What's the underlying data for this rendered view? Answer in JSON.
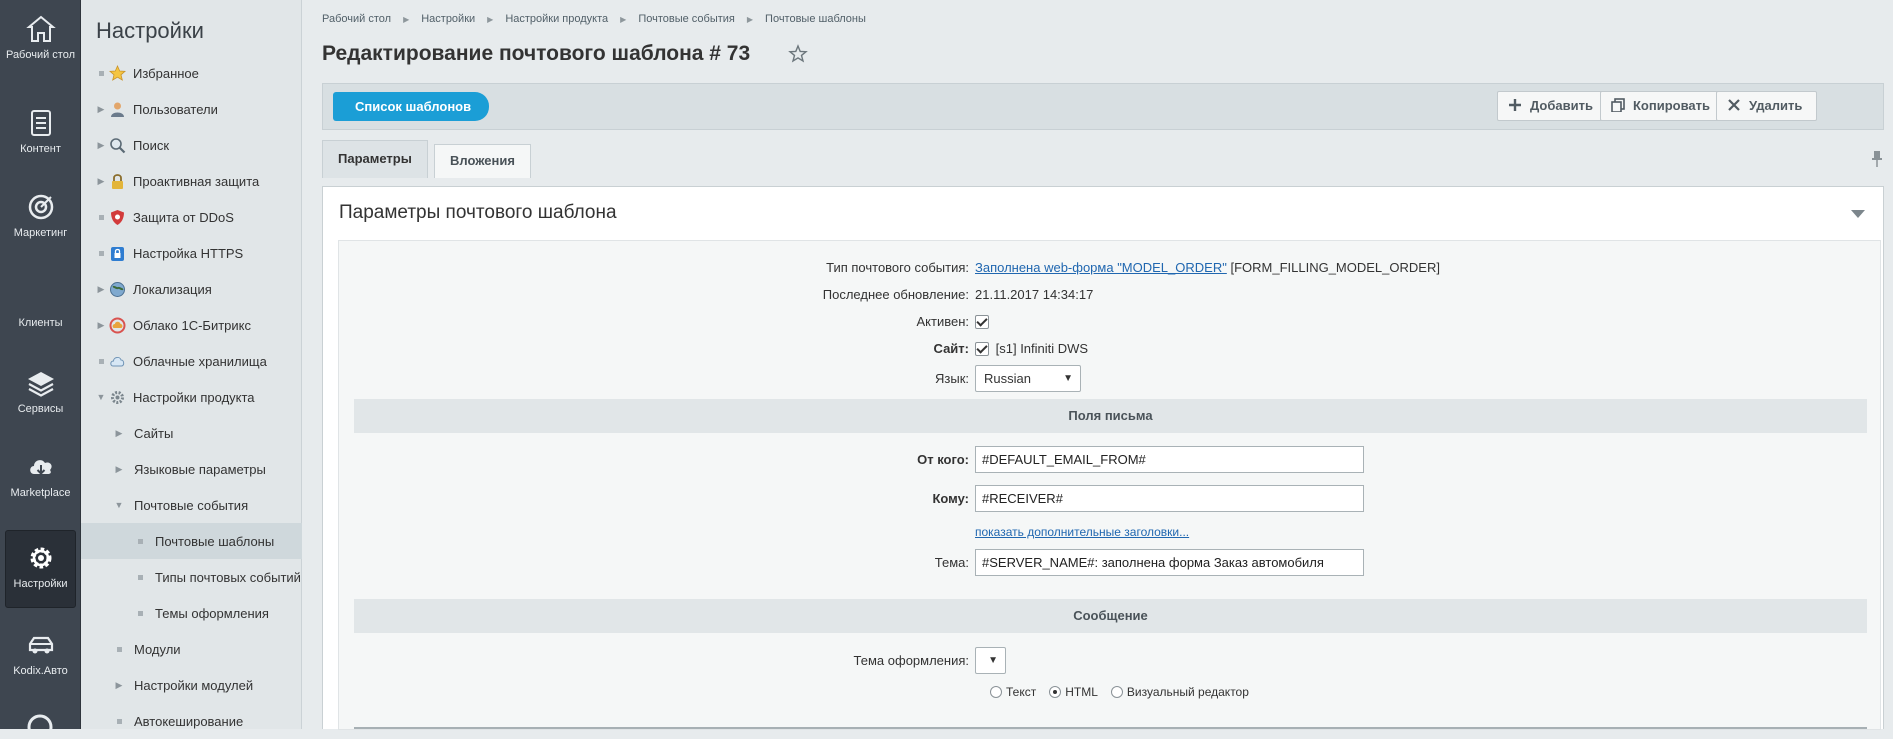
{
  "rail": {
    "items": [
      {
        "label": "Рабочий стол",
        "icon": "home-icon"
      },
      {
        "label": "Контент",
        "icon": "document-icon"
      },
      {
        "label": "Маркетинг",
        "icon": "target-icon"
      },
      {
        "label": "Клиенты",
        "icon": "clients-icon"
      },
      {
        "label": "Сервисы",
        "icon": "layers-icon"
      },
      {
        "label": "Marketplace",
        "icon": "cloud-download-icon"
      },
      {
        "label": "Настройки",
        "icon": "gear-icon"
      },
      {
        "label": "Kodix.Авто",
        "icon": "car-icon"
      }
    ]
  },
  "sidebar": {
    "title": "Настройки",
    "items": [
      {
        "label": "Избранное",
        "icon": "star-icon"
      },
      {
        "label": "Пользователи",
        "icon": "user-icon"
      },
      {
        "label": "Поиск",
        "icon": "magnifier-icon"
      },
      {
        "label": "Проактивная защита",
        "icon": "lock-icon"
      },
      {
        "label": "Защита от DDoS",
        "icon": "shield-icon"
      },
      {
        "label": "Настройка HTTPS",
        "icon": "https-lock-icon"
      },
      {
        "label": "Локализация",
        "icon": "globe-icon"
      },
      {
        "label": "Облако 1С-Битрикс",
        "icon": "cloud-bitrix-icon"
      },
      {
        "label": "Облачные хранилища",
        "icon": "cloud-storage-icon"
      },
      {
        "label": "Настройки продукта",
        "icon": "settings-cog-icon"
      },
      {
        "label": "Сайты"
      },
      {
        "label": "Языковые параметры"
      },
      {
        "label": "Почтовые события"
      },
      {
        "label": "Почтовые шаблоны"
      },
      {
        "label": "Типы почтовых событий"
      },
      {
        "label": "Темы оформления"
      },
      {
        "label": "Модули"
      },
      {
        "label": "Настройки модулей"
      },
      {
        "label": "Автокеширование"
      }
    ]
  },
  "breadcrumb": [
    "Рабочий стол",
    "Настройки",
    "Настройки продукта",
    "Почтовые события",
    "Почтовые шаблоны"
  ],
  "page_title": "Редактирование почтового шаблона # 73",
  "toolbar": {
    "list_label": "Список шаблонов",
    "add_label": "Добавить",
    "copy_label": "Копировать",
    "delete_label": "Удалить"
  },
  "tabs": [
    "Параметры",
    "Вложения"
  ],
  "panel": {
    "title": "Параметры почтового шаблона",
    "event_type_label": "Тип почтового события:",
    "event_type_link": "Заполнена web-форма \"MODEL_ORDER\"",
    "event_type_code": "[FORM_FILLING_MODEL_ORDER]",
    "updated_label": "Последнее обновление:",
    "updated_value": "21.11.2017 14:34:17",
    "active_label": "Активен:",
    "site_label": "Сайт:",
    "site_value": "[s1] Infiniti DWS",
    "lang_label": "Язык:",
    "lang_value": "Russian",
    "section_fields": "Поля письма",
    "from_label": "От кого:",
    "from_value": "#DEFAULT_EMAIL_FROM#",
    "to_label": "Кому:",
    "to_value": "#RECEIVER#",
    "more_headers_link": "показать дополнительные заголовки...",
    "subject_label": "Тема:",
    "subject_value": "#SERVER_NAME#: заполнена форма Заказ автомобиля",
    "section_message": "Сообщение",
    "theme_label": "Тема оформления:",
    "theme_value": "",
    "format_options": [
      "Текст",
      "HTML",
      "Визуальный редактор"
    ],
    "format_selected": "HTML"
  },
  "colors": {
    "rail_bg": "#3e4650",
    "sidebar_bg": "#e1e6e8",
    "accent_blue": "#1b9ed6",
    "link": "#2067b0"
  }
}
